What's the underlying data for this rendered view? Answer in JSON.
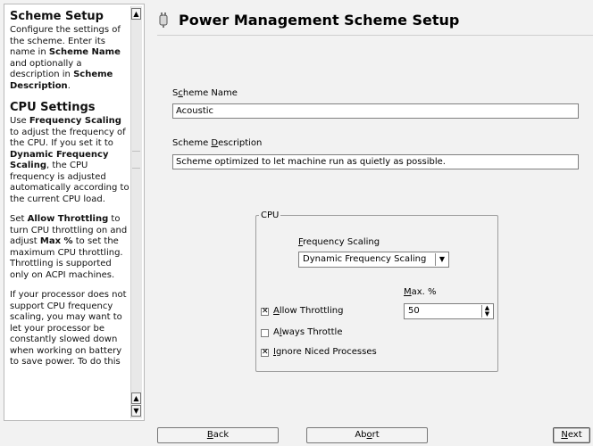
{
  "help": {
    "sections": [
      {
        "heading": "Scheme Setup",
        "paragraphs": [
          "Configure the settings of the scheme. Enter its name in Scheme Name and optionally a description in Scheme Description."
        ]
      },
      {
        "heading": "CPU Settings",
        "paragraphs": [
          "Use Frequency Scaling to adjust the frequency of the CPU. If you set it to Dynamic Frequency Scaling, the CPU frequency is adjusted automatically according to the current CPU load.",
          "Set Allow Throttling to turn CPU throttling on and adjust Max % to set the maximum CPU throttling. Throttling is supported only on ACPI machines.",
          "If your processor does not support CPU frequency scaling, you may want to let your processor be constantly slowed down when working on battery to save power. To do this"
        ]
      }
    ]
  },
  "header": {
    "title": "Power Management Scheme Setup",
    "icon": "power-plug-icon"
  },
  "form": {
    "scheme_name_label": "Scheme Name",
    "scheme_name_value": "Acoustic",
    "scheme_description_label": "Scheme Description",
    "scheme_description_value": "Scheme optimized to let machine run as quietly as possible."
  },
  "cpu": {
    "group_title": "CPU",
    "frequency_scaling_label": "Frequency Scaling",
    "frequency_scaling_value": "Dynamic Frequency Scaling",
    "max_label": "Max. %",
    "max_value": "50",
    "allow_throttling_label": "Allow Throttling",
    "allow_throttling_checked": true,
    "always_throttle_label": "Always Throttle",
    "always_throttle_checked": false,
    "ignore_niced_label": "Ignore Niced Processes",
    "ignore_niced_checked": true
  },
  "buttons": {
    "back": "Back",
    "abort": "Abort",
    "next": "Next"
  }
}
